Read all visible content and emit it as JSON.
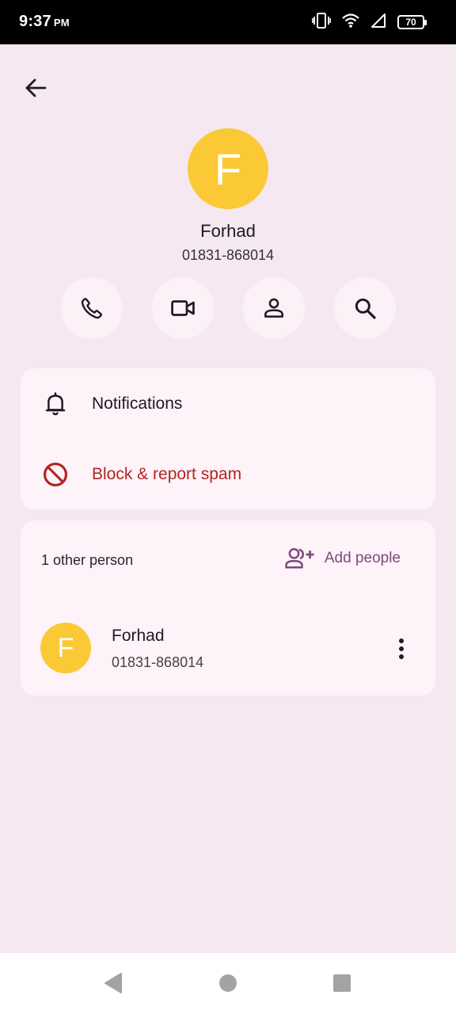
{
  "status_bar": {
    "time": "9:37",
    "ampm": "PM",
    "battery": "70",
    "icons": [
      "vibrate-icon",
      "wifi-icon",
      "signal-icon",
      "battery-icon"
    ]
  },
  "header": {
    "back_icon": "arrow-back-icon"
  },
  "contact": {
    "initial": "F",
    "name": "Forhad",
    "number": "01831-868014",
    "avatar_color": "#fbc935"
  },
  "actions": [
    {
      "icon": "phone-icon"
    },
    {
      "icon": "video-camera-icon"
    },
    {
      "icon": "person-icon"
    },
    {
      "icon": "search-icon"
    }
  ],
  "settings": {
    "notifications_label": "Notifications",
    "block_label": "Block & report spam",
    "block_color": "#b3261e"
  },
  "people": {
    "count_label": "1 other person",
    "add_label": "Add people",
    "accent_color": "#7e4a7d",
    "members": [
      {
        "initial": "F",
        "name": "Forhad",
        "number": "01831-868014"
      }
    ]
  },
  "nav": [
    "back-triangle-icon",
    "home-circle-icon",
    "recents-square-icon"
  ]
}
